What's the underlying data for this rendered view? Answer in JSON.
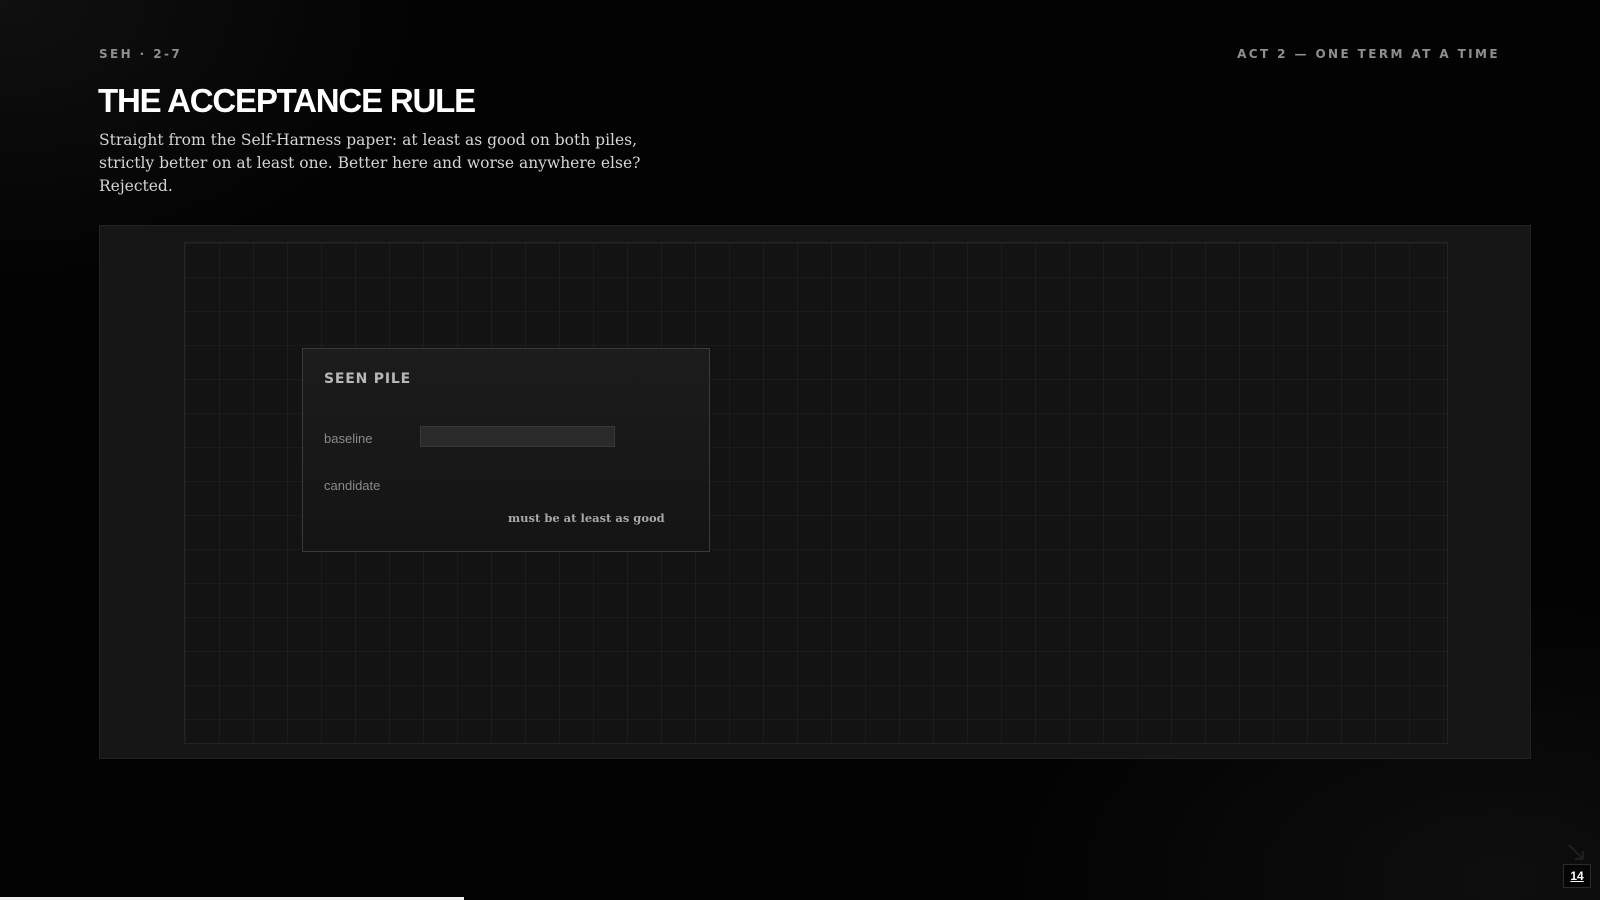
{
  "header": {
    "eyebrow": "SEH · 2-7",
    "act_label": "ACT 2 — ONE TERM AT A TIME",
    "title": "THE ACCEPTANCE RULE",
    "subtitle": "Straight from the Self-Harness paper: at least as good on both piles, strictly better on at least one. Better here and worse anywhere else? Rejected."
  },
  "pile": {
    "title": "SEEN PILE",
    "rows": [
      {
        "label": "baseline",
        "fill_fraction": 1.0
      },
      {
        "label": "candidate",
        "fill_fraction": 0.0
      }
    ],
    "note": "must be at least as good"
  },
  "progress": {
    "fraction": 0.29
  },
  "footer": {
    "page_number": "14"
  },
  "icons": {
    "corner": "diagonal-arrow-icon"
  }
}
